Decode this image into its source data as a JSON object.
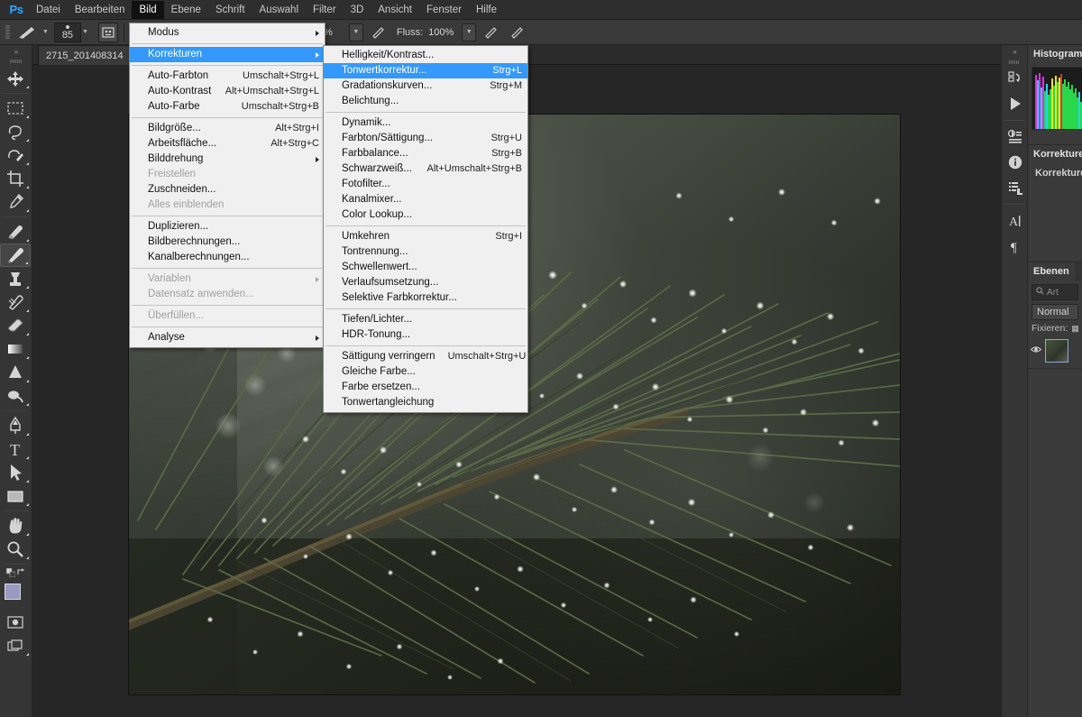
{
  "app": {
    "logo": "Ps"
  },
  "menubar": {
    "items": [
      {
        "label": "Datei",
        "active": false
      },
      {
        "label": "Bearbeiten",
        "active": false
      },
      {
        "label": "Bild",
        "active": true
      },
      {
        "label": "Ebene",
        "active": false
      },
      {
        "label": "Schrift",
        "active": false
      },
      {
        "label": "Auswahl",
        "active": false
      },
      {
        "label": "Filter",
        "active": false
      },
      {
        "label": "3D",
        "active": false
      },
      {
        "label": "Ansicht",
        "active": false
      },
      {
        "label": "Fenster",
        "active": false
      },
      {
        "label": "Hilfe",
        "active": false
      }
    ]
  },
  "options_bar": {
    "brush_size": "85",
    "flow_label": "Fluss:",
    "flow_value": "100%",
    "opacity_value": "%"
  },
  "document": {
    "tab_label": "2715_201408314"
  },
  "toolbar": {
    "tools": [
      {
        "name": "move-tool",
        "glyph": "move"
      },
      {
        "name": "marquee-tool",
        "glyph": "marquee"
      },
      {
        "name": "lasso-tool",
        "glyph": "lasso"
      },
      {
        "name": "quick-selection-tool",
        "glyph": "quickselect"
      },
      {
        "name": "crop-tool",
        "glyph": "crop"
      },
      {
        "name": "eyedropper-tool",
        "glyph": "eyedropper"
      },
      {
        "name": "healing-brush-tool",
        "glyph": "heal"
      },
      {
        "name": "brush-tool",
        "glyph": "brush",
        "selected": true
      },
      {
        "name": "clone-stamp-tool",
        "glyph": "stamp"
      },
      {
        "name": "history-brush-tool",
        "glyph": "historybrush"
      },
      {
        "name": "eraser-tool",
        "glyph": "eraser"
      },
      {
        "name": "gradient-tool",
        "glyph": "gradient"
      },
      {
        "name": "blur-tool",
        "glyph": "blur"
      },
      {
        "name": "dodge-tool",
        "glyph": "dodge"
      },
      {
        "name": "pen-tool",
        "glyph": "pen"
      },
      {
        "name": "type-tool",
        "glyph": "type"
      },
      {
        "name": "path-selection-tool",
        "glyph": "pathselect"
      },
      {
        "name": "rectangle-tool",
        "glyph": "rectangle"
      },
      {
        "name": "hand-tool",
        "glyph": "hand"
      },
      {
        "name": "zoom-tool",
        "glyph": "zoom"
      }
    ],
    "foreground_color": "#9a9ac0",
    "background_color": "#a33028"
  },
  "menu_bild": {
    "title": "Bild",
    "items": [
      {
        "label": "Modus",
        "shortcut": "",
        "submenu": true
      },
      {
        "divider": true
      },
      {
        "label": "Korrekturen",
        "shortcut": "",
        "submenu": true,
        "highlighted": true
      },
      {
        "divider": true
      },
      {
        "label": "Auto-Farbton",
        "shortcut": "Umschalt+Strg+L"
      },
      {
        "label": "Auto-Kontrast",
        "shortcut": "Alt+Umschalt+Strg+L"
      },
      {
        "label": "Auto-Farbe",
        "shortcut": "Umschalt+Strg+B"
      },
      {
        "divider": true
      },
      {
        "label": "Bildgröße...",
        "shortcut": "Alt+Strg+I"
      },
      {
        "label": "Arbeitsfläche...",
        "shortcut": "Alt+Strg+C"
      },
      {
        "label": "Bilddrehung",
        "shortcut": "",
        "submenu": true
      },
      {
        "label": "Freistellen",
        "shortcut": "",
        "disabled": true
      },
      {
        "label": "Zuschneiden...",
        "shortcut": ""
      },
      {
        "label": "Alles einblenden",
        "shortcut": "",
        "disabled": true
      },
      {
        "divider": true
      },
      {
        "label": "Duplizieren...",
        "shortcut": ""
      },
      {
        "label": "Bildberechnungen...",
        "shortcut": ""
      },
      {
        "label": "Kanalberechnungen...",
        "shortcut": ""
      },
      {
        "divider": true
      },
      {
        "label": "Variablen",
        "shortcut": "",
        "submenu": true,
        "disabled": true
      },
      {
        "label": "Datensatz anwenden...",
        "shortcut": "",
        "disabled": true
      },
      {
        "divider": true
      },
      {
        "label": "Überfüllen...",
        "shortcut": "",
        "disabled": true
      },
      {
        "divider": true
      },
      {
        "label": "Analyse",
        "shortcut": "",
        "submenu": true
      }
    ]
  },
  "menu_korrekturen": {
    "title": "Korrekturen",
    "items": [
      {
        "label": "Helligkeit/Kontrast...",
        "shortcut": ""
      },
      {
        "label": "Tonwertkorrektur...",
        "shortcut": "Strg+L",
        "highlighted": true
      },
      {
        "label": "Gradationskurven...",
        "shortcut": "Strg+M"
      },
      {
        "label": "Belichtung...",
        "shortcut": ""
      },
      {
        "divider": true
      },
      {
        "label": "Dynamik...",
        "shortcut": ""
      },
      {
        "label": "Farbton/Sättigung...",
        "shortcut": "Strg+U"
      },
      {
        "label": "Farbbalance...",
        "shortcut": "Strg+B"
      },
      {
        "label": "Schwarzweiß...",
        "shortcut": "Alt+Umschalt+Strg+B"
      },
      {
        "label": "Fotofilter...",
        "shortcut": ""
      },
      {
        "label": "Kanalmixer...",
        "shortcut": ""
      },
      {
        "label": "Color Lookup...",
        "shortcut": ""
      },
      {
        "divider": true
      },
      {
        "label": "Umkehren",
        "shortcut": "Strg+I"
      },
      {
        "label": "Tontrennung...",
        "shortcut": ""
      },
      {
        "label": "Schwellenwert...",
        "shortcut": ""
      },
      {
        "label": "Verlaufsumsetzung...",
        "shortcut": ""
      },
      {
        "label": "Selektive Farbkorrektur...",
        "shortcut": ""
      },
      {
        "divider": true
      },
      {
        "label": "Tiefen/Lichter...",
        "shortcut": ""
      },
      {
        "label": "HDR-Tonung...",
        "shortcut": ""
      },
      {
        "divider": true
      },
      {
        "label": "Sättigung verringern",
        "shortcut": "Umschalt+Strg+U"
      },
      {
        "label": "Gleiche Farbe...",
        "shortcut": ""
      },
      {
        "label": "Farbe ersetzen...",
        "shortcut": ""
      },
      {
        "label": "Tonwertangleichung",
        "shortcut": ""
      }
    ]
  },
  "right_panels": {
    "histogram": {
      "tab": "Histogramm"
    },
    "corrections": {
      "tab": "Korrekturen",
      "heading": "Korrekturen"
    },
    "layers": {
      "tab": "Ebenen",
      "search_placeholder": "Art",
      "blend_mode": "Normal",
      "lock_label": "Fixieren:"
    }
  },
  "icon_dock": {
    "items": [
      {
        "name": "history-panel-icon"
      },
      {
        "name": "actions-panel-icon"
      },
      {
        "name": "adjustments-panel-icon"
      },
      {
        "name": "info-panel-icon"
      },
      {
        "name": "layer-comps-panel-icon"
      },
      {
        "name": "character-panel-icon"
      },
      {
        "name": "paragraph-panel-icon"
      }
    ]
  },
  "colors": {
    "accent": "#31a8ff",
    "menu_highlight": "#3399ff",
    "chrome": "#353535",
    "canvas": "#262626"
  }
}
